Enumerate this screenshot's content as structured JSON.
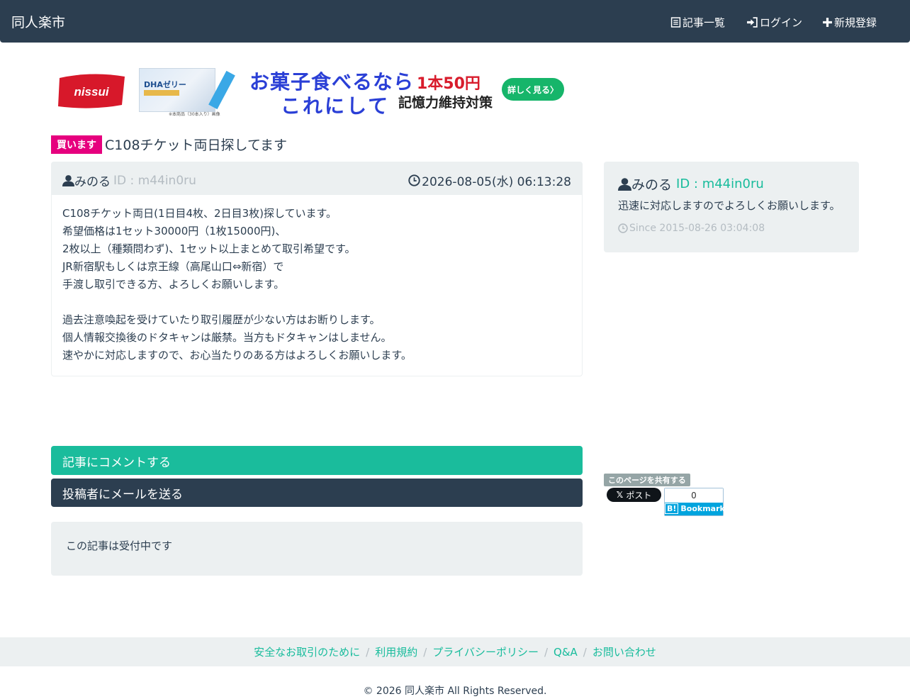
{
  "navbar": {
    "brand": "同人楽市",
    "items": [
      {
        "label": "記事一覧",
        "icon": "list-icon"
      },
      {
        "label": "ログイン",
        "icon": "login-icon"
      },
      {
        "label": "新規登録",
        "icon": "plus-icon"
      }
    ]
  },
  "ad": {
    "logo_text": "nissui",
    "product_text": "DHAゼリー",
    "caption": "※本商品（30本入り）画像",
    "headline1": "お菓子食べるなら",
    "headline2": "これにして",
    "price": "1本50円",
    "tagline": "記憶力維持対策",
    "cta": "詳しく見る〉",
    "colors": {
      "headline": "#2a3fd6",
      "price": "#d81c2c",
      "cta": "#16b56a",
      "logo": "#d7182a"
    }
  },
  "post": {
    "badge": "買います",
    "title": "C108チケット両日探してます",
    "user_name": "みのる",
    "user_id": "ID : m44in0ru",
    "datetime": "2026-08-05(水) 06:13:28",
    "body": [
      "C108チケット両日(1日目4枚、2日目3枚)探しています。",
      "希望価格は1セット30000円（1枚15000円)、",
      "2枚以上（種類問わず)、1セット以上まとめて取引希望です。",
      "JR新宿駅もしくは京王線（高尾山口⇔新宿）で",
      "手渡し取引できる方、よろしくお願いします。",
      "",
      "過去注意喚起を受けていたり取引履歴が少ない方はお断りします。",
      "個人情報交換後のドタキャンは厳禁。当方もドタキャンはしません。",
      "速やかに対応しますので、お心当たりのある方はよろしくお願いします。"
    ]
  },
  "actions": {
    "comment": "記事にコメントする",
    "mail": "投稿者にメールを送る"
  },
  "status_text": "この記事は受付中です",
  "sidebar": {
    "user_name": "みのる",
    "user_id": "ID : m44in0ru",
    "message": "迅速に対応しますのでよろしくお願いします。",
    "since": "Since 2015-08-26 03:04:08"
  },
  "share": {
    "label": "このページを共有する",
    "x_button": "ポスト",
    "hatena_count": "0",
    "hatena_label": "Bookmark"
  },
  "footer": {
    "links": [
      "安全なお取引のために",
      "利用規約",
      "プライバシーポリシー",
      "Q&A",
      "お問い合わせ"
    ],
    "copyright": "© 2026 同人楽市 All Rights Reserved."
  },
  "colors": {
    "primary": "#2c3e50",
    "success": "#18bc9c",
    "light": "#ecf0f1",
    "badge": "#e6007e",
    "muted": "#b4bcc2"
  }
}
